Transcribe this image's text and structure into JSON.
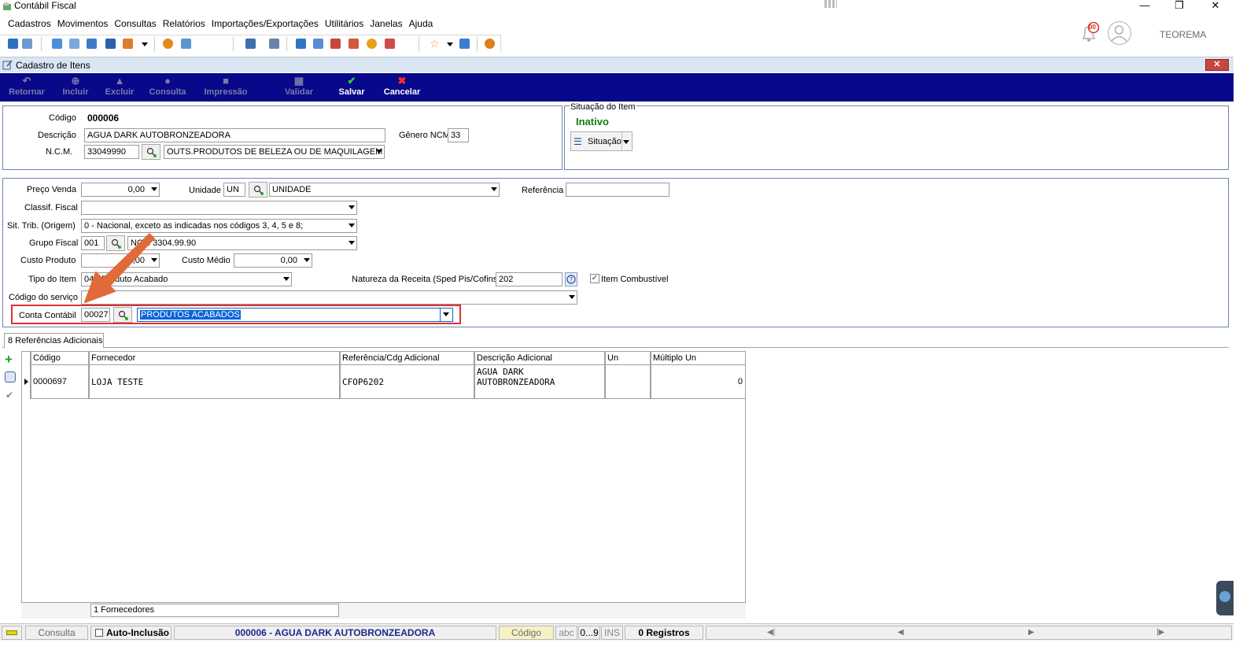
{
  "app": {
    "title": "Contábil Fiscal"
  },
  "menu": [
    "Cadastros",
    "Movimentos",
    "Consultas",
    "Relatórios",
    "Importações/Exportações",
    "Utilitários",
    "Janelas",
    "Ajuda"
  ],
  "header": {
    "notif_count": "00",
    "user": "TEOREMA"
  },
  "window": {
    "title": "Cadastro de Itens"
  },
  "actions": {
    "retornar": "Retornar",
    "incluir": "Incluir",
    "excluir": "Excluir",
    "consulta": "Consulta",
    "impressao": "Impressão",
    "validar": "Validar",
    "salvar": "Salvar",
    "cancelar": "Cancelar"
  },
  "item": {
    "codigo_label": "Código",
    "codigo": "000006",
    "descricao_label": "Descrição",
    "descricao": "AGUA DARK AUTOBRONZEADORA",
    "genero_label": "Gênero NCM",
    "genero": "33",
    "ncm_label": "N.C.M.",
    "ncm": "33049990",
    "ncm_desc": "OUTS.PRODUTOS DE BELEZA OU DE MAQUILAGEM"
  },
  "situacao": {
    "group_label": "Situação do Item",
    "status": "Inativo",
    "button": "Situação",
    "status_color": "#0f7d0f"
  },
  "form": {
    "preco_label": "Preço Venda",
    "preco": "0,00",
    "unidade_label": "Unidade",
    "unidade": "UN",
    "unidade_desc": "UNIDADE",
    "referencia_label": "Referência",
    "referencia": "",
    "classif_label": "Classif. Fiscal",
    "classif": "",
    "sittrib_label": "Sit. Trib. (Origem)",
    "sittrib": "0 - Nacional, exceto as indicadas nos códigos 3, 4, 5 e 8;",
    "grupo_label": "Grupo Fiscal",
    "grupo": "001",
    "grupo_desc": "NCM 3304.99.90",
    "custo_label": "Custo Produto",
    "custo": "0,00",
    "custo_medio_label": "Custo Médio",
    "custo_medio": "0,00",
    "tipo_label": "Tipo do Item",
    "tipo": "04 - Produto Acabado",
    "natureza_label": "Natureza da Receita (Sped Pis/Cofins)",
    "natureza": "202",
    "combustivel_label": "Item Combustível",
    "servico_label": "Código do serviço",
    "servico": "",
    "conta_label": "Conta Contábil",
    "conta": "00027",
    "conta_desc": "PRODUTOS ACABADOS"
  },
  "tab": {
    "label": "8 Referências Adicionais"
  },
  "grid": {
    "columns": [
      "Código",
      "Fornecedor",
      "Referência/Cdg Adicional",
      "Descrição Adicional",
      "Un",
      "Múltiplo Un"
    ],
    "rows": [
      {
        "codigo": "0000697",
        "fornecedor": "LOJA  TESTE",
        "referencia": "CFOP6202",
        "descricao": "AGUA DARK AUTOBRONZEADORA",
        "un": "",
        "multiplo": "0"
      }
    ],
    "footer": "1 Fornecedores"
  },
  "status": {
    "mode": "Consulta",
    "auto_label": "Auto-Inclusão",
    "record": "000006 - AGUA DARK AUTOBRONZEADORA",
    "sort": "Código",
    "abc": "abc",
    "num": "0...9",
    "ins": "INS",
    "registros": "0 Registros"
  },
  "colors": {
    "action_bar": "#08088a",
    "highlight": "#0a64d8",
    "annotation": "#e06a3a",
    "box": "#e03030"
  }
}
